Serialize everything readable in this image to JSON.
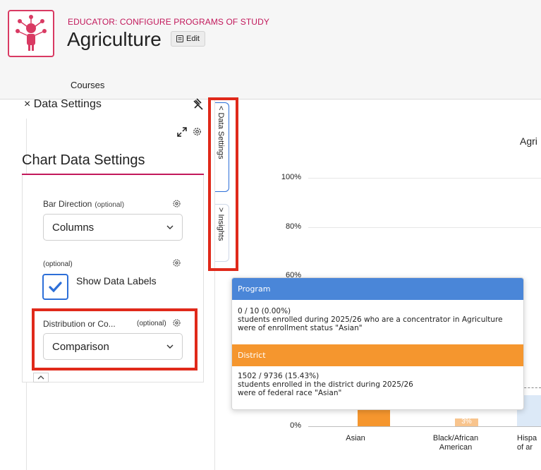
{
  "header": {
    "eyebrow": "EDUCATOR: CONFIGURE PROGRAMS OF STUDY",
    "title": "Agriculture",
    "edit_label": "Edit",
    "tabs": [
      {
        "label": "Courses"
      }
    ],
    "accent_color": "#c2185b"
  },
  "data_settings": {
    "close_label": "× Data Settings",
    "panel_title": "Chart Data Settings",
    "bar_direction": {
      "label": "Bar Direction",
      "optional": "(optional)",
      "value": "Columns"
    },
    "data_labels": {
      "optional": "(optional)",
      "label": "Show Data Labels",
      "checked": true
    },
    "distribution": {
      "label": "Distribution or Co...",
      "optional": "(optional)",
      "value": "Comparison"
    }
  },
  "side_tabs": [
    {
      "label": "< Data Settings",
      "active": true
    },
    {
      "label": "> Insights",
      "active": false
    }
  ],
  "chart": {
    "title_fragment": "Agri",
    "y_ticks": [
      "100%",
      "80%",
      "60%",
      "0%"
    ],
    "categories": [
      {
        "line1": "Asian",
        "line2": ""
      },
      {
        "line1": "Black/African",
        "line2": "American"
      },
      {
        "line1": "Hispa",
        "line2": "of ar"
      }
    ],
    "bar_label_black": "3%"
  },
  "chart_data": {
    "type": "bar",
    "categories": [
      "Asian",
      "Black/African American",
      "Hispa..."
    ],
    "series": [
      {
        "name": "Program",
        "values": [
          0,
          null,
          null
        ],
        "color": "#4a86d8"
      },
      {
        "name": "District",
        "values": [
          15.43,
          3,
          null
        ],
        "color": "#f5962e"
      }
    ],
    "ylabel": "",
    "ylim": [
      0,
      100
    ]
  },
  "tooltip": {
    "program": {
      "label": "Program",
      "line1": "0 / 10 (0.00%)",
      "line2": "students enrolled during 2025/26 who are a concentrator in Agriculture",
      "line3": "were of enrollment status \"Asian\"",
      "color": "#4a86d8"
    },
    "district": {
      "label": "District",
      "line1": "1502 / 9736 (15.43%)",
      "line2": "students enrolled in the district during 2025/26",
      "line3": "were of federal race \"Asian\"",
      "color": "#f5962e"
    }
  },
  "icons": [
    "logo-icon",
    "edit-icon",
    "pin-off-icon",
    "expand-icon",
    "gear-icon",
    "chevron-down-icon",
    "checkmark-icon",
    "chevron-up-icon"
  ]
}
